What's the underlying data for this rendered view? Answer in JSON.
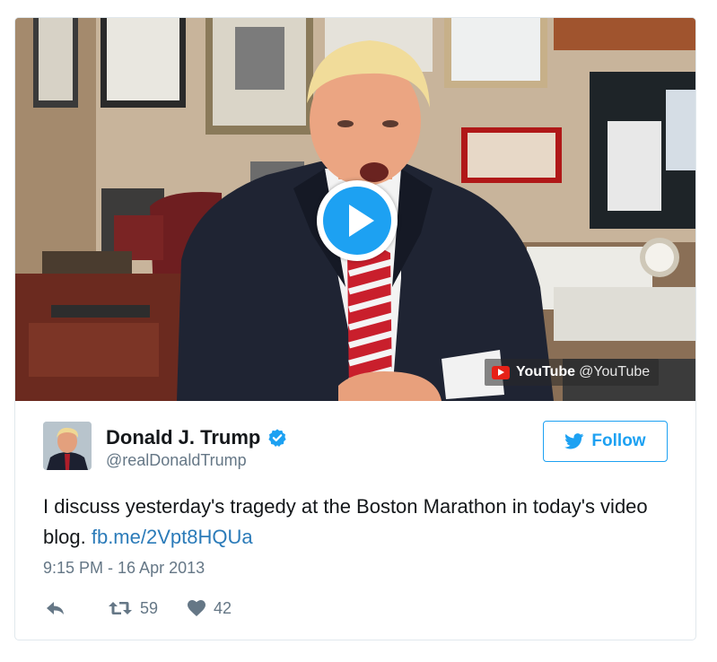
{
  "media": {
    "provider": "YouTube",
    "provider_handle": "@YouTube"
  },
  "author": {
    "name": "Donald J. Trump",
    "handle": "@realDonaldTrump"
  },
  "follow": {
    "label": "Follow"
  },
  "tweet": {
    "text": "I discuss yesterday's tragedy at the Boston Marathon in today's video blog.",
    "link": "fb.me/2Vpt8HQUa",
    "timestamp": "9:15 PM - 16 Apr 2013"
  },
  "actions": {
    "reply_icon": "reply-icon",
    "retweet_count": "59",
    "like_count": "42"
  },
  "colors": {
    "accent": "#1da1f2",
    "link": "#2b7bb9",
    "muted": "#657786",
    "youtube_red": "#e62117"
  }
}
